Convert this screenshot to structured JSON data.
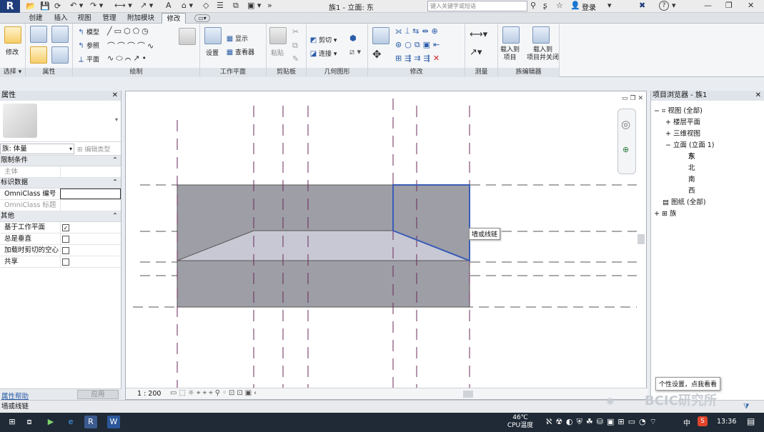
{
  "titlebar": {
    "logo": "R",
    "title": "族1 - 立面: 东",
    "search_placeholder": "键入关键字或短语",
    "login": "登录",
    "help": "?"
  },
  "tabs": [
    "创建",
    "插入",
    "视图",
    "管理",
    "附加模块",
    "修改"
  ],
  "active_tab": "修改",
  "ribbon": {
    "select_group": {
      "button": "修改",
      "label": "选择 ▾"
    },
    "properties_label": "属性",
    "draw": {
      "label": "绘制",
      "items": [
        "模型",
        "参照",
        "平面"
      ]
    },
    "workplane": {
      "label": "工作平面",
      "set": "设置",
      "show": "显示",
      "viewer": "查看器"
    },
    "clipboard": {
      "label": "剪贴板",
      "paste": "粘贴"
    },
    "geometry": {
      "label": "几何图形",
      "cut": "剪切",
      "join": "连接"
    },
    "modify_label": "修改",
    "measure_label": "测量",
    "family_editor": {
      "label": "族编辑器",
      "load": "载入到\n项目",
      "load_close": "载入到\n项目并关闭"
    }
  },
  "properties": {
    "title": "属性",
    "family_type": "族: 体量",
    "edit_type": "编辑类型",
    "sections": [
      {
        "name": "限制条件",
        "rows": [
          {
            "key": "主体",
            "value": ""
          }
        ]
      },
      {
        "name": "标识数据",
        "rows": [
          {
            "key": "OmniClass 编号",
            "value": ""
          },
          {
            "key": "OmniClass 标题",
            "value": ""
          }
        ]
      },
      {
        "name": "其他",
        "rows": [
          {
            "key": "基于工作平面",
            "checked": true
          },
          {
            "key": "总是垂直",
            "checked": false
          },
          {
            "key": "加载时剪切的空心",
            "checked": false
          },
          {
            "key": "共享",
            "checked": false
          }
        ]
      }
    ],
    "help_link": "属性帮助",
    "apply": "应用"
  },
  "canvas": {
    "tooltip": "墙或线链",
    "scale": "1 : 200"
  },
  "project_browser": {
    "title": "项目浏览器 - 族1",
    "tree": [
      {
        "label": "视图 (全部)",
        "level": 0,
        "expander": "−"
      },
      {
        "label": "楼层平面",
        "level": 1,
        "expander": "+"
      },
      {
        "label": "三维视图",
        "level": 1,
        "expander": "+"
      },
      {
        "label": "立面 (立面 1)",
        "level": 1,
        "expander": "−"
      },
      {
        "label": "东",
        "level": 2,
        "bold": true
      },
      {
        "label": "北",
        "level": 2
      },
      {
        "label": "南",
        "level": 2
      },
      {
        "label": "西",
        "level": 2
      },
      {
        "label": "图纸 (全部)",
        "level": 0,
        "expander": ""
      },
      {
        "label": "族",
        "level": 0,
        "expander": "+"
      }
    ],
    "popup": "个性设置，点我看看"
  },
  "statusbar": {
    "text": "墙或线链",
    "watermark": "BCIC研究所"
  },
  "taskbar": {
    "temp": "46℃",
    "temp_label": "CPU温度",
    "ime": "中",
    "time": "13:36"
  },
  "colors": {
    "accent": "#2a5da8",
    "shape_fill": "#9e9ea6",
    "selection": "#3a5db5",
    "gridline": "#6a2a5a"
  }
}
